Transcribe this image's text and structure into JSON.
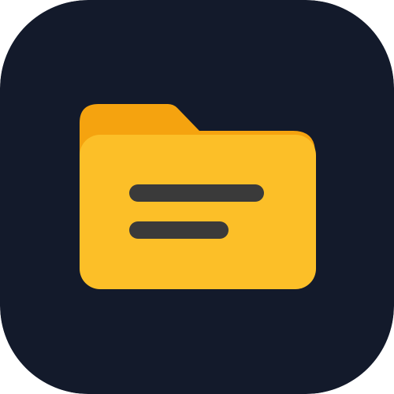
{
  "icon": {
    "name": "folder-document-icon",
    "colors": {
      "background": "#131a2b",
      "folder_front": "#fcbf28",
      "folder_back": "#f5a30f",
      "lines": "#3a3a3a"
    },
    "lines_count": 2
  }
}
